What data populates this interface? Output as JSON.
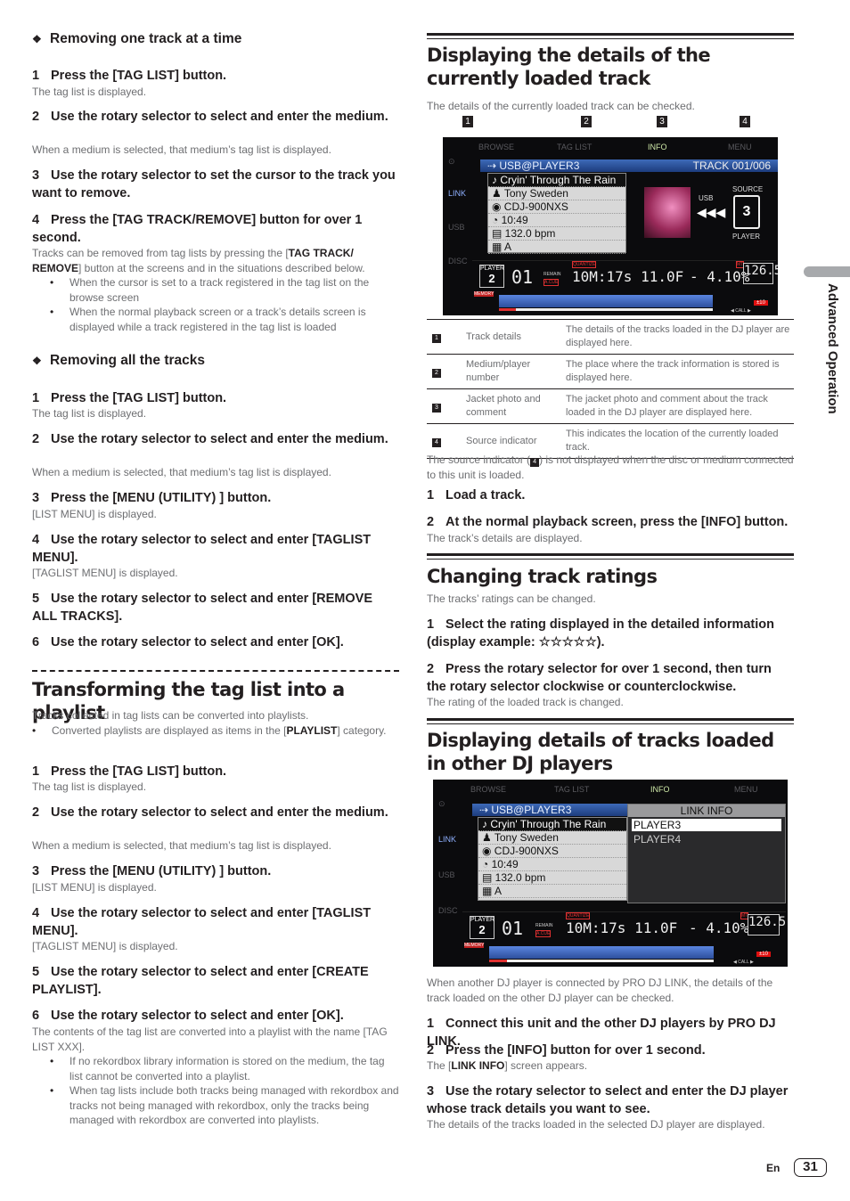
{
  "left": {
    "remove_one": {
      "heading": "Removing one track at a time",
      "steps": [
        {
          "n": "1",
          "text": "Press the [TAG LIST] button.",
          "note": "The tag list is displayed."
        },
        {
          "n": "2",
          "text": "Use the rotary selector to select and enter the medium.",
          "note": "When a medium is selected, that medium’s tag list is displayed."
        },
        {
          "n": "3",
          "text": "Use the rotary selector to set the cursor to the track you want to remove."
        },
        {
          "n": "4",
          "text": "Press the [TAG TRACK/REMOVE] button for over 1 second.",
          "note_pre": "Tracks can be removed from tag lists by pressing the [",
          "note_bold": "TAG TRACK/ REMOVE",
          "note_post": "] button at the screens and in the situations described below."
        }
      ],
      "bullets": [
        "When the cursor is set to a track registered in the tag list on the browse screen",
        "When the normal playback screen or a track’s details screen is displayed while a track registered in the tag list is loaded"
      ]
    },
    "remove_all": {
      "heading": "Removing all the tracks",
      "steps": [
        {
          "n": "1",
          "text": "Press the [TAG LIST] button.",
          "note": "The tag list is displayed."
        },
        {
          "n": "2",
          "text": "Use the rotary selector to select and enter the medium.",
          "note": "When a medium is selected, that medium’s tag list is displayed."
        },
        {
          "n": "3",
          "text": "Press the [MENU (UTILITY) ] button.",
          "note": "[LIST MENU] is displayed."
        },
        {
          "n": "4",
          "text": "Use the rotary selector to select and enter [TAGLIST MENU].",
          "note": "[TAGLIST MENU] is displayed."
        },
        {
          "n": "5",
          "text": "Use the rotary selector to select and enter [REMOVE ALL TRACKS]."
        },
        {
          "n": "6",
          "text": "Use the rotary selector to select and enter [OK]."
        }
      ]
    },
    "transform": {
      "heading": "Transforming the tag list into a playlist",
      "intro": "Tracks collected in tag lists can be converted into playlists.",
      "intro_bullet_pre": "Converted playlists are displayed as items in the [",
      "intro_bullet_bold": "PLAYLIST",
      "intro_bullet_post": "] category.",
      "steps": [
        {
          "n": "1",
          "text": "Press the [TAG LIST] button.",
          "note": "The tag list is displayed."
        },
        {
          "n": "2",
          "text": "Use the rotary selector to select and enter the medium.",
          "note": "When a medium is selected, that medium’s tag list is displayed."
        },
        {
          "n": "3",
          "text": "Press the [MENU (UTILITY) ] button.",
          "note": "[LIST MENU] is displayed."
        },
        {
          "n": "4",
          "text": "Use the rotary selector to select and enter [TAGLIST MENU].",
          "note": "[TAGLIST MENU] is displayed."
        },
        {
          "n": "5",
          "text": "Use the rotary selector to select and enter [CREATE PLAYLIST]."
        },
        {
          "n": "6",
          "text": "Use the rotary selector to select and enter [OK].",
          "note": "The contents of the tag list are converted into a playlist with the name [TAG LIST XXX]."
        }
      ],
      "bullets": [
        "If no rekordbox library information is stored on the medium, the tag list cannot be converted into a playlist.",
        "When tag lists include both tracks being managed with rekordbox and tracks not being managed with rekordbox, only the tracks being managed with rekordbox are converted into playlists."
      ]
    }
  },
  "right": {
    "details": {
      "heading": "Displaying the details of the currently loaded track",
      "intro": "The details of the currently loaded track can be checked.",
      "callouts": [
        "1",
        "2",
        "3",
        "4"
      ],
      "table": [
        {
          "num": "1",
          "item": "Track details",
          "desc": "The details of the tracks loaded in the DJ player are displayed here."
        },
        {
          "num": "2",
          "item": "Medium/player number",
          "desc": "The place where the track information is stored is displayed here."
        },
        {
          "num": "3",
          "item": "Jacket photo and comment",
          "desc": "The jacket photo and comment about the track loaded in the DJ player are displayed here."
        },
        {
          "num": "4",
          "item": "Source indicator",
          "desc": "This indicates the location of the currently loaded track."
        }
      ],
      "source_note_pre": "The source indicator (",
      "source_note_badge": "4",
      "source_note_post": ") is not displayed when the disc or medium connected to this unit is loaded.",
      "steps": [
        {
          "n": "1",
          "text": "Load a track."
        },
        {
          "n": "2",
          "text": "At the normal playback screen, press the [INFO] button.",
          "note": "The track’s details are displayed."
        }
      ]
    },
    "ratings": {
      "heading": "Changing track ratings",
      "intro": "The tracks’ ratings can be changed.",
      "steps": [
        {
          "n": "1",
          "text": "Select the rating displayed in the detailed information (display example: ☆☆☆☆☆)."
        },
        {
          "n": "2",
          "text": "Press the rotary selector for over 1 second, then turn the rotary selector clockwise or counterclockwise.",
          "note": "The rating of the loaded track is changed."
        }
      ]
    },
    "other_players": {
      "heading": "Displaying details of tracks loaded in other DJ players",
      "intro": "When another DJ player is connected by PRO DJ LINK, the details of the track loaded on the other DJ player can be checked.",
      "steps": [
        {
          "n": "1",
          "text": "Connect this unit and the other DJ players by PRO DJ LINK."
        },
        {
          "n": "2",
          "text": "Press the [INFO] button for over 1 second.",
          "note_pre": "The [",
          "note_bold": "LINK INFO",
          "note_post": "] screen appears."
        },
        {
          "n": "3",
          "text": "Use the rotary selector to select and enter the DJ player whose track details you want to see.",
          "note": "The details of the tracks loaded in the selected DJ player are displayed."
        }
      ]
    }
  },
  "screen": {
    "tabs": [
      "BROWSE",
      "TAG LIST",
      "INFO",
      "MENU"
    ],
    "active_tab": "INFO",
    "side": [
      "LINK",
      "USB",
      "DISC"
    ],
    "header": "⇢ USB@PLAYER3",
    "track_count": "TRACK 001/006",
    "rows": [
      "♪ Cryin' Through The Rain",
      "♟ Tony Sweden",
      "◉ CDJ-900NXS",
      "◔ 10:49",
      "▤ 132.0 bpm",
      "▦ A"
    ],
    "source_label": "SOURCE",
    "player_label": "PLAYER",
    "usb_label": "USB",
    "player_num": "2",
    "track_num": "01",
    "time": "10M:17s 11.0F",
    "tempo": "- 4.10%",
    "bpm": "126.5",
    "quantize": "QUANTIZE",
    "remain": "REMAIN",
    "auto_cue": "A.CUE",
    "mt": "MT",
    "tempo_range": "±10",
    "memory": "MEMORY",
    "call": "◀ CALL ▶",
    "link_info_title": "LINK INFO",
    "link_players": [
      "PLAYER3",
      "PLAYER4"
    ]
  },
  "side_tab": "Advanced Operation",
  "footer": {
    "lang": "En",
    "page": "31"
  }
}
